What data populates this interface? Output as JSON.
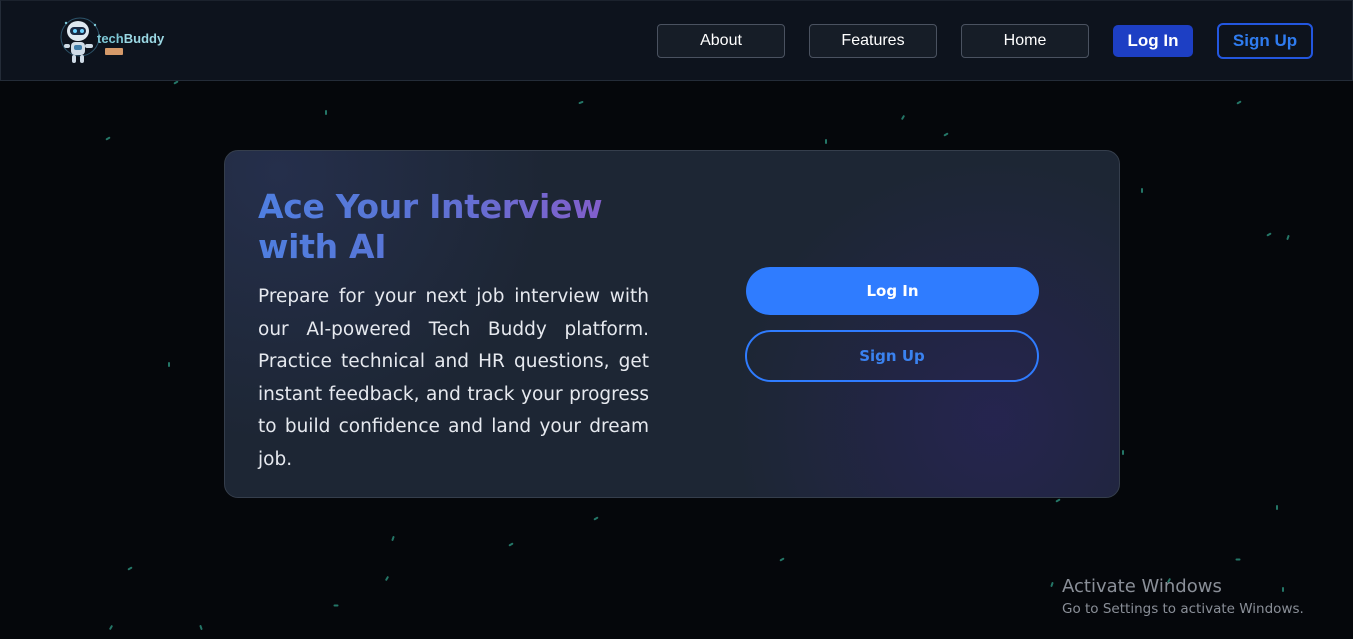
{
  "navbar": {
    "logo_text_prefix": "tech",
    "logo_text_suffix": "Buddy",
    "links": [
      {
        "label": "About"
      },
      {
        "label": "Features"
      },
      {
        "label": "Home"
      }
    ],
    "login_label": "Log In",
    "signup_label": "Sign Up"
  },
  "hero": {
    "title_line1": "Ace Your Interview",
    "title_line2": "with AI",
    "description": "Prepare for your next job interview with our AI-powered Tech Buddy platform. Practice technical and HR questions, get instant feedback, and track your progress to build confidence and land your dream job.",
    "login_label": "Log In",
    "signup_label": "Sign Up"
  },
  "windows_watermark": {
    "title": "Activate Windows",
    "subtitle": "Go to Settings to activate Windows."
  },
  "colors": {
    "background": "#05070b",
    "navbar": "#0d131d",
    "card": "#1d2634",
    "primary": "#2f7cff",
    "nav_login": "#1d3fc4",
    "title_gradient_start": "#4f7fe0",
    "title_gradient_end": "#8a5ac9",
    "star": "#2a8a78"
  }
}
